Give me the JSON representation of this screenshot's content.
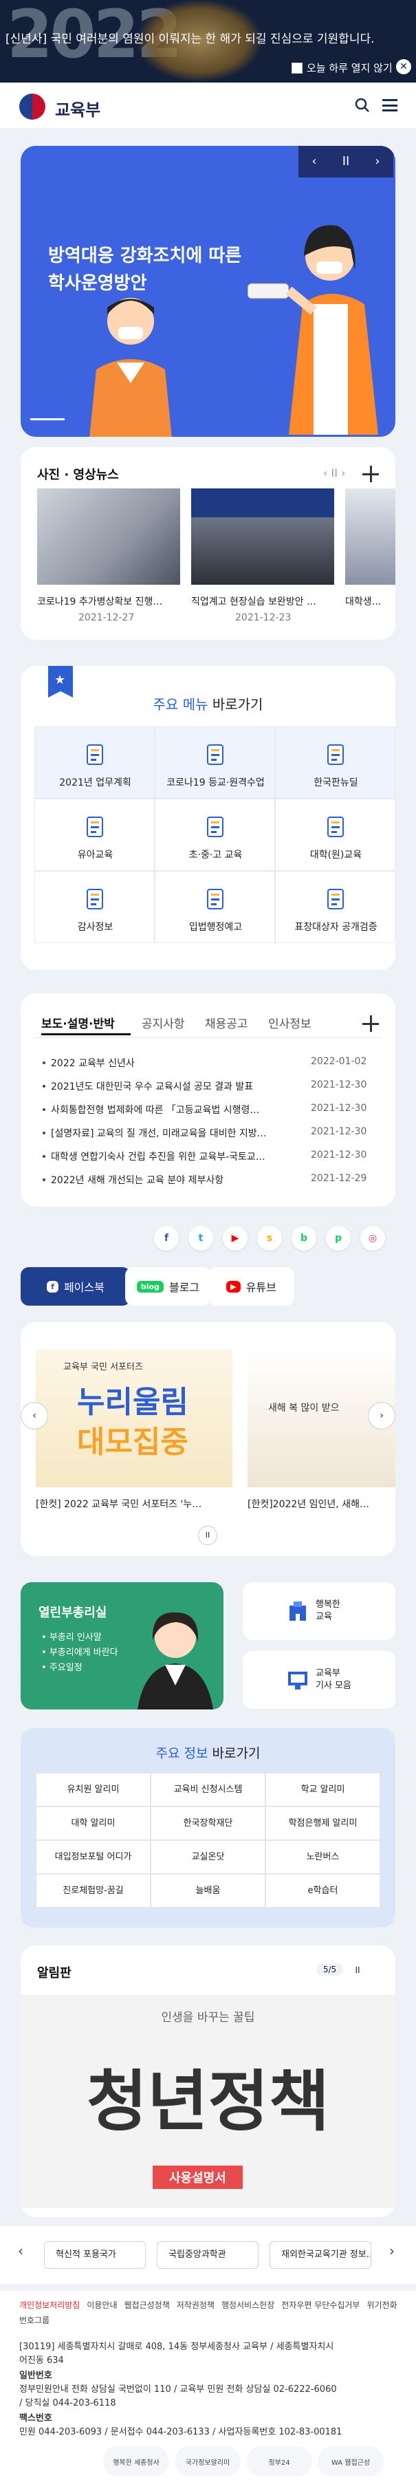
{
  "top_banner": {
    "year": "2022",
    "message": "[신년사] 국민 여러분의 염원이 이뤄지는 한 해가 되길 진심으로 기원합니다.",
    "hide_today_label": "오늘 하루 열지 않기",
    "close_icon": "close-icon"
  },
  "header": {
    "logo_text": "교육부",
    "search_icon": "search-icon",
    "menu_icon": "hamburger-icon"
  },
  "hero": {
    "title_line1": "방역대응 강화조치에 따른",
    "title_line2": "학사운영방안",
    "controls": [
      "‹",
      "II",
      "›"
    ]
  },
  "photo_news": {
    "title": "사진 · 영상뉴스",
    "pager": "‹ II ›",
    "items": [
      {
        "caption": "코로나19 추가병상확보 진행…",
        "date": "2021-12-27"
      },
      {
        "caption": "직업계고 현장실습 보완방안 …",
        "date": "2021-12-23"
      },
      {
        "caption": "대학생…",
        "date": ""
      }
    ]
  },
  "main_menu": {
    "title_accent": "주요 메뉴",
    "title_rest": " 바로가기",
    "items": [
      {
        "label": "2021년 업무계획",
        "icon": "document-pen-icon"
      },
      {
        "label": "코로나19 등교·원격수업",
        "icon": "monitor-icon"
      },
      {
        "label": "한국판뉴딜",
        "icon": "lightbulb-icon"
      },
      {
        "label": "유아교육",
        "icon": "child-icon"
      },
      {
        "label": "초·중·고 교육",
        "icon": "notebook-icon"
      },
      {
        "label": "대학(원)교육",
        "icon": "graduation-cap-icon"
      },
      {
        "label": "감사정보",
        "icon": "audit-icon"
      },
      {
        "label": "입법행정예고",
        "icon": "notice-board-icon"
      },
      {
        "label": "표창대상자 공개검증",
        "icon": "award-icon"
      }
    ]
  },
  "news": {
    "tabs": [
      "보도·설명·반박",
      "공지사항",
      "채용공고",
      "인사정보"
    ],
    "rows": [
      {
        "title": "2022 교육부 신년사",
        "date": "2022-01-02"
      },
      {
        "title": "2021년도 대한민국 우수 교육시설 공모 결과 발표",
        "date": "2021-12-30"
      },
      {
        "title": "사회통합전형 법제화에 따른 「고등교육법 시행령…",
        "date": "2021-12-30"
      },
      {
        "title": "[설명자료] 교육의 질 개선, 미래교육을 대비한 지방…",
        "date": "2021-12-30"
      },
      {
        "title": "대학생 연합기숙사 건립 추진을 위한 교육부-국토교…",
        "date": "2021-12-30"
      },
      {
        "title": "2022년 새해 개선되는 교육 분야 제부사항",
        "date": "2021-12-29"
      }
    ]
  },
  "social": {
    "icons": [
      {
        "name": "facebook-icon",
        "glyph": "f",
        "color": "#3b5998"
      },
      {
        "name": "twitter-icon",
        "glyph": "t",
        "color": "#1da1f2"
      },
      {
        "name": "youtube-icon",
        "glyph": "▶",
        "color": "#ff0000"
      },
      {
        "name": "kakaostory-icon",
        "glyph": "s",
        "color": "#f2b400"
      },
      {
        "name": "naver-blog-icon",
        "glyph": "b",
        "color": "#19ce60"
      },
      {
        "name": "naver-post-icon",
        "glyph": "p",
        "color": "#19ce60"
      },
      {
        "name": "instagram-icon",
        "glyph": "◎",
        "color": "#c13584"
      }
    ],
    "tabs": [
      {
        "label": "페이스북",
        "badge": "f"
      },
      {
        "label": "블로그",
        "badge": "blog"
      },
      {
        "label": "유튜브",
        "badge": "▶"
      }
    ],
    "posts": [
      {
        "caption": "[한컷] 2022 교육부 국민 서포터즈 '누…",
        "img_line1": "교육부 국민 서포터즈",
        "img_line2": "누리울림",
        "img_line3": "대모집중"
      },
      {
        "caption": "[한컷]2022년 임인년, 새해…",
        "img_line1": "새해 복 많이 받으"
      }
    ],
    "pause": "II"
  },
  "ministers": {
    "title": "열린부총리실",
    "items": [
      "부총리 인사말",
      "부총리에게 바란다",
      "주요일정"
    ],
    "side1": "행복한\n교육",
    "side2": "교육부\n기사 모음"
  },
  "key_info": {
    "title_accent": "주요 정보",
    "title_rest": " 바로가기",
    "items": [
      "유치원 알리미",
      "교육비 신청시스템",
      "학교 알리미",
      "대학 알리미",
      "한국장학재단",
      "학점은행제 알리미",
      "대입정보포털 어디가",
      "교실온닷",
      "노란버스",
      "진로체험망-꿈길",
      "늘배움",
      "e학습터"
    ]
  },
  "bulletin": {
    "title": "알림판",
    "pager": "5/5",
    "banner_sub": "인생을 바꾸는 꿀팁",
    "banner_main": "청년정책",
    "banner_badge": "사용설명서"
  },
  "related_links": [
    "혁신적 포용국가",
    "국립중앙과학관",
    "재외한국교육기관 정보…"
  ],
  "footer": {
    "policy_links": [
      "개인정보처리방침",
      "이용안내",
      "웹접근성정책",
      "저작권정책",
      "행정서비스헌장",
      "전자우편 무단수집거부",
      "위기전화번호그룹"
    ],
    "address": "[30119] 세종특별자치시 갈매로 408, 14동 정부세종청사 교육부 / 세종특별자치시",
    "address2": "어진동 634",
    "phone_title": "일반번호",
    "phone": "정부민원안내 전화 상담실 국번없이 110 / 교육부 민원 전화 상담실 02-6222-6060",
    "phone2": "/ 당직실 044-203-6118",
    "fax_title": "팩스번호",
    "fax": "민원 044-203-6093 / 문서접수 044-203-6133 / 사업자등록번호 102-83-00181",
    "logos": [
      "행복한 세종청사",
      "국가정보알리미",
      "정부24",
      "WA 웹접근성"
    ]
  }
}
